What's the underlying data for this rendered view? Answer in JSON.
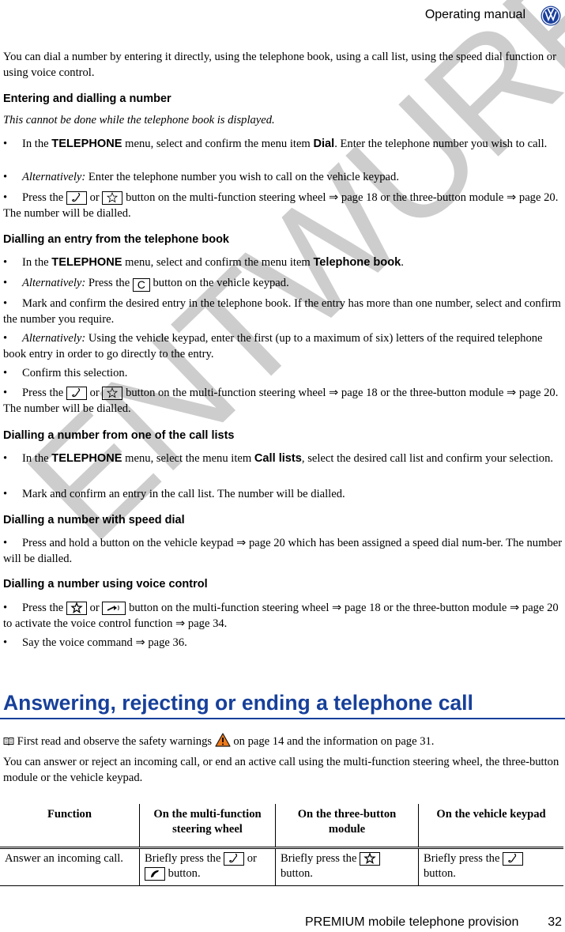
{
  "header": {
    "title": "Operating manual",
    "logo": "vw-logo"
  },
  "intro": "You can dial a number by entering it directly, using the telephone book, using a call list, using the speed dial function or using voice control.",
  "sections": {
    "entering": {
      "title": "Entering and dialling a number",
      "note": "This cannot be done while the telephone book is displayed.",
      "b1": {
        "pre": "In the ",
        "menu": "TELEPHONE",
        "mid": " menu, select and confirm the menu item ",
        "item": "Dial",
        "post": ". Enter the telephone number you wish to call."
      },
      "b2": {
        "alt": "Alternatively:",
        "text": " Enter the telephone number you wish to call on the vehicle keypad."
      },
      "b3": {
        "pre": "Press the ",
        "or": " or ",
        "post": " button on the multi-function steering wheel ⇒ page 18 or the three-button module ⇒ page 20. The number will be dialled."
      }
    },
    "book": {
      "title": "Dialling an entry from the telephone book",
      "b1": {
        "pre": "In the ",
        "menu": "TELEPHONE",
        "mid": " menu, select and confirm the menu item ",
        "item": "Telephone book",
        "post": "."
      },
      "b2": {
        "alt": "Alternatively:",
        "pre": " Press the ",
        "key": "C",
        "post": " button on the vehicle keypad."
      },
      "b3": "Mark and confirm the desired entry in the telephone book. If the entry has more than one number, select and confirm the number you require.",
      "b4": {
        "alt": "Alternatively:",
        "text": " Using the vehicle keypad, enter the first (up to a maximum of six) letters of the required telephone book entry in order to go directly to the entry."
      },
      "b5": "Confirm this selection.",
      "b6": {
        "pre": "Press the ",
        "or": " or ",
        "post": " button on the multi-function steering wheel ⇒ page 18 or the three-button module ⇒ page 20. The number will be dialled."
      }
    },
    "calllists": {
      "title": "Dialling a number from one of the call lists",
      "b1": {
        "pre": "In the ",
        "menu": "TELEPHONE",
        "mid": " menu, select the menu item ",
        "item": "Call lists",
        "post": ", select the desired call list and confirm your selection."
      },
      "b2": "Mark and confirm an entry in the call list. The number will be dialled."
    },
    "speed": {
      "title": "Dialling a number with speed dial",
      "b1": "Press and hold a button on the vehicle keypad ⇒ page 20 which has been assigned a speed dial num-ber. The number will be dialled."
    },
    "voice": {
      "title": "Dialling a number using voice control",
      "b1": {
        "pre": "Press the ",
        "or": " or ",
        "post": " button on the multi-function steering wheel ⇒ page 18 or the three-button module ⇒ page 20 to activate the voice control function ⇒ page 34."
      },
      "b2": "Say the voice command ⇒ page 36."
    }
  },
  "answering": {
    "title": "Answering, rejecting or ending a telephone call",
    "safety": {
      "pre": " First read and observe the safety warnings ",
      "post": " on page 14 and the information on page 31."
    },
    "intro": "You can answer or reject an incoming call, or end an active call using the multi-function steering wheel, the three-button module or the vehicle keypad.",
    "table": {
      "headers": [
        "Function",
        "On the multi-function steering wheel",
        "On the three-button module",
        "On the vehicle keypad"
      ],
      "rows": [
        {
          "function": "Answer an incoming call.",
          "wheel": {
            "pre": "Briefly press the ",
            "or": " or",
            "post": " button."
          },
          "module": {
            "pre": "Briefly press the ",
            "post": "button."
          },
          "keypad": {
            "pre": "Briefly press the ",
            "post": "button."
          }
        }
      ]
    }
  },
  "watermark": "ENTWURF",
  "footer": {
    "title": "PREMIUM mobile telephone provision",
    "page": "32"
  },
  "colors": {
    "heading_blue": "#17409a",
    "vw_blue": "#1a3f9c",
    "warning_orange": "#f07a1a",
    "watermark_gray": "#c8c8c8"
  }
}
